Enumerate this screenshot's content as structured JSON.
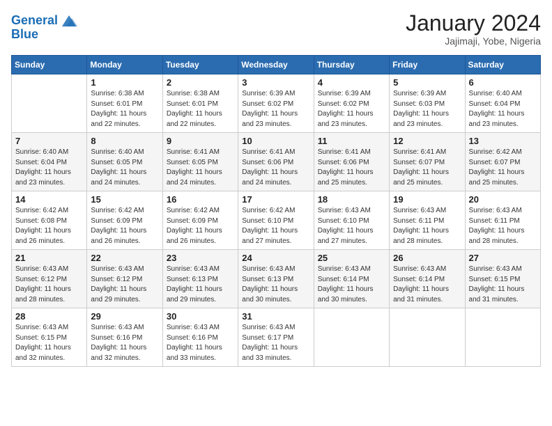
{
  "header": {
    "logo_line1": "General",
    "logo_line2": "Blue",
    "month": "January 2024",
    "location": "Jajimaji, Yobe, Nigeria"
  },
  "weekdays": [
    "Sunday",
    "Monday",
    "Tuesday",
    "Wednesday",
    "Thursday",
    "Friday",
    "Saturday"
  ],
  "weeks": [
    [
      {
        "day": "",
        "info": ""
      },
      {
        "day": "1",
        "info": "Sunrise: 6:38 AM\nSunset: 6:01 PM\nDaylight: 11 hours\nand 22 minutes."
      },
      {
        "day": "2",
        "info": "Sunrise: 6:38 AM\nSunset: 6:01 PM\nDaylight: 11 hours\nand 22 minutes."
      },
      {
        "day": "3",
        "info": "Sunrise: 6:39 AM\nSunset: 6:02 PM\nDaylight: 11 hours\nand 23 minutes."
      },
      {
        "day": "4",
        "info": "Sunrise: 6:39 AM\nSunset: 6:02 PM\nDaylight: 11 hours\nand 23 minutes."
      },
      {
        "day": "5",
        "info": "Sunrise: 6:39 AM\nSunset: 6:03 PM\nDaylight: 11 hours\nand 23 minutes."
      },
      {
        "day": "6",
        "info": "Sunrise: 6:40 AM\nSunset: 6:04 PM\nDaylight: 11 hours\nand 23 minutes."
      }
    ],
    [
      {
        "day": "7",
        "info": "Sunrise: 6:40 AM\nSunset: 6:04 PM\nDaylight: 11 hours\nand 23 minutes."
      },
      {
        "day": "8",
        "info": "Sunrise: 6:40 AM\nSunset: 6:05 PM\nDaylight: 11 hours\nand 24 minutes."
      },
      {
        "day": "9",
        "info": "Sunrise: 6:41 AM\nSunset: 6:05 PM\nDaylight: 11 hours\nand 24 minutes."
      },
      {
        "day": "10",
        "info": "Sunrise: 6:41 AM\nSunset: 6:06 PM\nDaylight: 11 hours\nand 24 minutes."
      },
      {
        "day": "11",
        "info": "Sunrise: 6:41 AM\nSunset: 6:06 PM\nDaylight: 11 hours\nand 25 minutes."
      },
      {
        "day": "12",
        "info": "Sunrise: 6:41 AM\nSunset: 6:07 PM\nDaylight: 11 hours\nand 25 minutes."
      },
      {
        "day": "13",
        "info": "Sunrise: 6:42 AM\nSunset: 6:07 PM\nDaylight: 11 hours\nand 25 minutes."
      }
    ],
    [
      {
        "day": "14",
        "info": "Sunrise: 6:42 AM\nSunset: 6:08 PM\nDaylight: 11 hours\nand 26 minutes."
      },
      {
        "day": "15",
        "info": "Sunrise: 6:42 AM\nSunset: 6:09 PM\nDaylight: 11 hours\nand 26 minutes."
      },
      {
        "day": "16",
        "info": "Sunrise: 6:42 AM\nSunset: 6:09 PM\nDaylight: 11 hours\nand 26 minutes."
      },
      {
        "day": "17",
        "info": "Sunrise: 6:42 AM\nSunset: 6:10 PM\nDaylight: 11 hours\nand 27 minutes."
      },
      {
        "day": "18",
        "info": "Sunrise: 6:43 AM\nSunset: 6:10 PM\nDaylight: 11 hours\nand 27 minutes."
      },
      {
        "day": "19",
        "info": "Sunrise: 6:43 AM\nSunset: 6:11 PM\nDaylight: 11 hours\nand 28 minutes."
      },
      {
        "day": "20",
        "info": "Sunrise: 6:43 AM\nSunset: 6:11 PM\nDaylight: 11 hours\nand 28 minutes."
      }
    ],
    [
      {
        "day": "21",
        "info": "Sunrise: 6:43 AM\nSunset: 6:12 PM\nDaylight: 11 hours\nand 28 minutes."
      },
      {
        "day": "22",
        "info": "Sunrise: 6:43 AM\nSunset: 6:12 PM\nDaylight: 11 hours\nand 29 minutes."
      },
      {
        "day": "23",
        "info": "Sunrise: 6:43 AM\nSunset: 6:13 PM\nDaylight: 11 hours\nand 29 minutes."
      },
      {
        "day": "24",
        "info": "Sunrise: 6:43 AM\nSunset: 6:13 PM\nDaylight: 11 hours\nand 30 minutes."
      },
      {
        "day": "25",
        "info": "Sunrise: 6:43 AM\nSunset: 6:14 PM\nDaylight: 11 hours\nand 30 minutes."
      },
      {
        "day": "26",
        "info": "Sunrise: 6:43 AM\nSunset: 6:14 PM\nDaylight: 11 hours\nand 31 minutes."
      },
      {
        "day": "27",
        "info": "Sunrise: 6:43 AM\nSunset: 6:15 PM\nDaylight: 11 hours\nand 31 minutes."
      }
    ],
    [
      {
        "day": "28",
        "info": "Sunrise: 6:43 AM\nSunset: 6:15 PM\nDaylight: 11 hours\nand 32 minutes."
      },
      {
        "day": "29",
        "info": "Sunrise: 6:43 AM\nSunset: 6:16 PM\nDaylight: 11 hours\nand 32 minutes."
      },
      {
        "day": "30",
        "info": "Sunrise: 6:43 AM\nSunset: 6:16 PM\nDaylight: 11 hours\nand 33 minutes."
      },
      {
        "day": "31",
        "info": "Sunrise: 6:43 AM\nSunset: 6:17 PM\nDaylight: 11 hours\nand 33 minutes."
      },
      {
        "day": "",
        "info": ""
      },
      {
        "day": "",
        "info": ""
      },
      {
        "day": "",
        "info": ""
      }
    ]
  ]
}
